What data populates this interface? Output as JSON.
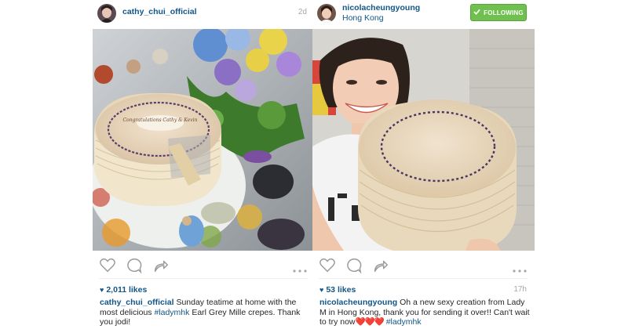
{
  "left_post": {
    "username": "cathy_chui_official",
    "time_ago": "2d",
    "likes": "2,011 likes",
    "caption": {
      "username": "cathy_chui_official",
      "text_a": " Sunday teatime at home with the most delicious ",
      "tag_1": "#ladymhk",
      "text_b": " Earl Grey Mille crepes. Thank you jodi!"
    },
    "cake_writing": "Congratulations Cathy & Kevin"
  },
  "right_post": {
    "username": "nicolacheungyoung",
    "location": "Hong Kong",
    "follow_label": "FOLLOWING",
    "time_ago": "17h",
    "likes": "53 likes",
    "caption": {
      "username": "nicolacheungyoung",
      "text_a": " Oh a new sexy creation from Lady M in Hong Kong, thank you for sending it over!! Can't wait to try now",
      "emoji": "❤️❤️❤️",
      "tag_1": "#ladymhk"
    }
  },
  "icons": [
    "heart-icon",
    "comment-icon",
    "share-icon",
    "more-options-icon",
    "check-icon"
  ],
  "colors": {
    "link_blue": "#125688",
    "follow_green": "#70c050",
    "muted_gray": "#a5a7aa"
  }
}
